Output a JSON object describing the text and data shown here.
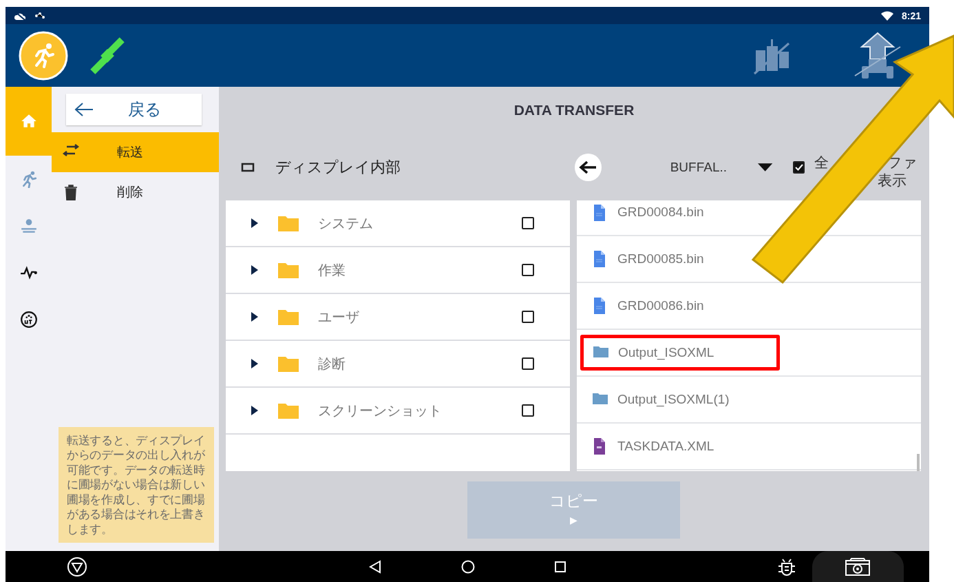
{
  "status_bar": {
    "time": "8:21"
  },
  "rail": {
    "items": [
      {
        "kind": "home",
        "selected": true
      },
      {
        "kind": "run",
        "selected": false
      },
      {
        "kind": "field",
        "selected": false
      },
      {
        "kind": "pulse",
        "selected": false
      },
      {
        "kind": "ut",
        "selected": false
      }
    ]
  },
  "side_panel": {
    "back_label": "戻る",
    "items": [
      {
        "kind": "transfer",
        "label": "転送",
        "selected": true
      },
      {
        "kind": "delete",
        "label": "削除",
        "selected": false
      }
    ],
    "note": "転送すると、ディスプレイからのデータの出し入れが可能です。データの転送時に圃場がない場合は新しい圃場を作成し、すでに圃場がある場合はそれを上書きします。"
  },
  "main": {
    "title": "DATA TRANSFER",
    "left_pane": {
      "title": "ディスプレイ内部",
      "folders": [
        {
          "name": "システム",
          "expanded": false,
          "checked": false
        },
        {
          "name": "作業",
          "expanded": false,
          "checked": false
        },
        {
          "name": "ユーザ",
          "expanded": false,
          "checked": false
        },
        {
          "name": "診断",
          "expanded": false,
          "checked": false
        },
        {
          "name": "スクリーンショット",
          "expanded": false,
          "checked": false
        }
      ]
    },
    "right_pane": {
      "device": "BUFFAL..",
      "show_all": {
        "checked": true,
        "label_parts": [
          "全",
          "ファ",
          "表示"
        ]
      },
      "files": [
        {
          "kind": "bin",
          "name": "GRD00084.bin",
          "highlighted": false
        },
        {
          "kind": "bin",
          "name": "GRD00085.bin",
          "highlighted": false
        },
        {
          "kind": "bin",
          "name": "GRD00086.bin",
          "highlighted": false
        },
        {
          "kind": "folder",
          "name": "Output_ISOXML",
          "highlighted": true
        },
        {
          "kind": "folder",
          "name": "Output_ISOXML(1)",
          "highlighted": false
        },
        {
          "kind": "xml",
          "name": "TASKDATA.XML",
          "highlighted": false
        }
      ]
    },
    "copy_button": {
      "label": "コピー",
      "arrow": "▶"
    }
  },
  "callout_arrow": true
}
